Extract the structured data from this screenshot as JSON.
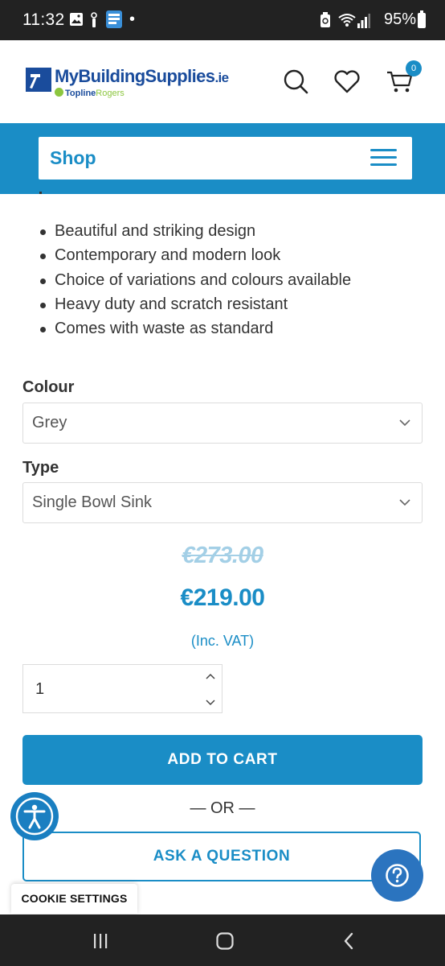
{
  "status_bar": {
    "time": "11:32",
    "battery_percent": "95%",
    "dot": "•"
  },
  "header": {
    "logo": {
      "name": "MyBuildingSupplies",
      "tld": ".ie",
      "sub_brand_1": "Topline",
      "sub_brand_2": "Rogers"
    },
    "icons": [
      "search-icon",
      "heart-icon",
      "cart-icon"
    ],
    "cart_count": "0"
  },
  "shop_bar": {
    "label": "Shop",
    "menu_icon": "hamburger-icon"
  },
  "features": [
    "Beautiful and striking design",
    "Contemporary and modern look",
    "Choice of variations and colours available",
    "Heavy duty and scratch resistant",
    "Comes with waste as standard"
  ],
  "options": {
    "colour_label": "Colour",
    "colour_value": "Grey",
    "type_label": "Type",
    "type_value": "Single Bowl Sink"
  },
  "price": {
    "old": "€273.00",
    "new": "€219.00",
    "vat_note": "(Inc. VAT)"
  },
  "quantity": {
    "value": "1"
  },
  "buttons": {
    "add_to_cart": "ADD TO CART",
    "or": "— OR —",
    "ask_question": "ASK A QUESTION",
    "cookie_settings": "COOKIE SETTINGS"
  },
  "colors": {
    "brand_blue": "#1a8dc6",
    "logo_navy": "#1a4c9c",
    "logo_green": "#8cc63f",
    "system_bar": "#222222"
  }
}
